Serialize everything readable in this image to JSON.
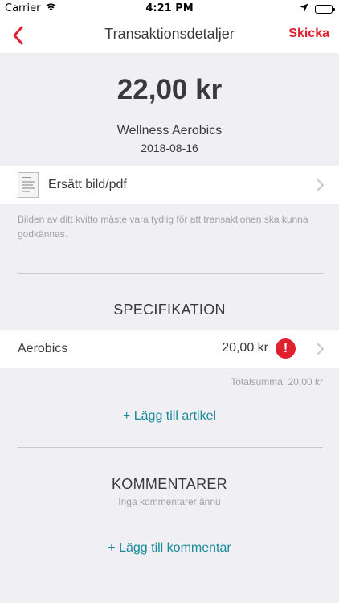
{
  "status_bar": {
    "carrier": "Carrier",
    "time": "4:21 PM",
    "icons": [
      "wifi-icon",
      "location-arrow-icon",
      "battery-icon"
    ]
  },
  "nav": {
    "back_icon": "chevron-left-icon",
    "title": "Transaktionsdetaljer",
    "action_label": "Skicka",
    "accent_color": "#e0202f"
  },
  "transaction": {
    "amount": "22,00 kr",
    "merchant": "Wellness Aerobics",
    "date": "2018-08-16"
  },
  "receipt": {
    "thumbnail_icon": "receipt-thumbnail",
    "label": "Ersätt bild/pdf",
    "hint": "Bilden av ditt kvitto måste vara tydlig för att transaktionen ska kunna godkännas."
  },
  "specification": {
    "title": "SPECIFIKATION",
    "items": [
      {
        "label": "Aerobics",
        "amount": "20,00 kr",
        "alert": "!"
      }
    ],
    "total": "Totalsumma: 20,00 kr",
    "add_label": "+ Lägg till artikel"
  },
  "comments": {
    "title": "KOMMENTARER",
    "empty_text": "Inga kommentarer ännu",
    "add_label": "+ Lägg till kommentar"
  },
  "colors": {
    "link": "#1a8a9a",
    "alert": "#e0202f",
    "background": "#efeff4"
  }
}
